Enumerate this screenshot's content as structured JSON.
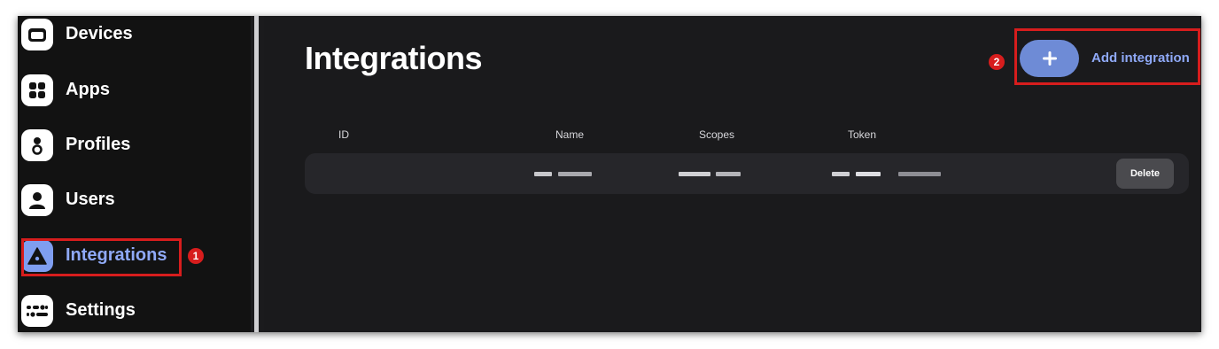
{
  "sidebar": {
    "items": [
      {
        "label": "Devices",
        "icon": "device-icon",
        "active": false
      },
      {
        "label": "Apps",
        "icon": "apps-grid-icon",
        "active": false
      },
      {
        "label": "Profiles",
        "icon": "profiles-icon",
        "active": false
      },
      {
        "label": "Users",
        "icon": "user-icon",
        "active": false
      },
      {
        "label": "Integrations",
        "icon": "integrations-icon",
        "active": true
      },
      {
        "label": "Settings",
        "icon": "settings-icon",
        "active": false
      }
    ]
  },
  "main": {
    "title": "Integrations",
    "add_button": {
      "icon": "plus-icon",
      "label": "Add integration"
    },
    "table": {
      "columns": [
        "ID",
        "Name",
        "Scopes",
        "Token"
      ],
      "rows": [
        {
          "id": "",
          "name": "[redacted]",
          "scopes": "[redacted]",
          "token": "[redacted]",
          "action_label": "Delete"
        }
      ]
    }
  },
  "annotations": [
    {
      "number": "1",
      "target": "sidebar-item-integrations"
    },
    {
      "number": "2",
      "target": "add-integration-button"
    }
  ],
  "colors": {
    "background": "#1a1a1c",
    "sidebar": "#121212",
    "accent": "#8fa9f7",
    "add_button": "#6e8bd6",
    "annotation": "#d71d1d"
  }
}
